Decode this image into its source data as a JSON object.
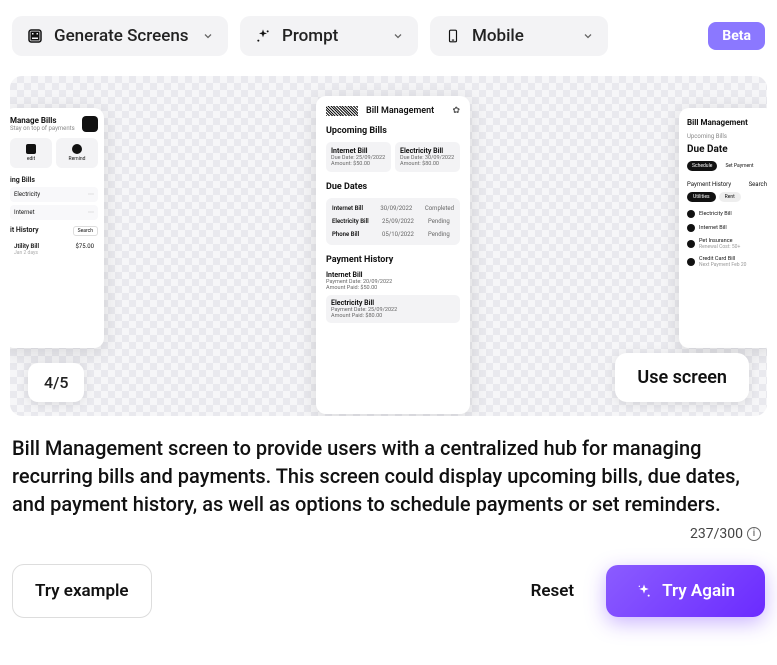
{
  "topbar": {
    "d1": "Generate Screens",
    "d2": "Prompt",
    "d3": "Mobile",
    "beta": "Beta"
  },
  "carousel": {
    "counter": "4/5",
    "use": "Use screen"
  },
  "cardLeft": {
    "title": "Manage Bills",
    "sub": "Stay on top of payments",
    "tab1": "edit",
    "tab2": "Remind",
    "sec1": "ing Bills",
    "r1": "Electricity",
    "r2": "Internet",
    "sec2": "it History",
    "search": "Search",
    "r3": "Jtility Bill",
    "r3s": "Jan 2 days",
    "amt": "$75.00"
  },
  "cardMid": {
    "title": "Bill Management",
    "h1": "Upcoming Bills",
    "p1n": "Internet Bill",
    "p1d1": "Due Date: 25/09/2022",
    "p1d2": "Amount: $50.00",
    "p2n": "Electricity Bill",
    "p2d1": "Due Date: 30/09/2022",
    "p2d2": "Amount: $80.00",
    "h2": "Due Dates",
    "t1a": "Internet Bill",
    "t1b": "30/09/2022",
    "t1c": "Completed",
    "t2a": "Electricity Bill",
    "t2b": "25/09/2022",
    "t2c": "Pending",
    "t3a": "Phone Bill",
    "t3b": "05/10/2022",
    "t3c": "Pending",
    "h3": "Payment History",
    "ph1n": "Internet Bill",
    "ph1d1": "Payment Date: 20/09/2022",
    "ph1d2": "Amount Paid: $50.00",
    "ph2n": "Electricity Bill",
    "ph2d1": "Payment Date: 25/09/2022",
    "ph2d2": "Amount Paid: $80.00"
  },
  "cardRight": {
    "title": "Bill Management",
    "lbl": "Upcoming Bills",
    "big": "Due Date",
    "chip1": "Schedule",
    "chip2": "Set Payment",
    "sec": "Payment History",
    "srch": "Search",
    "p2a": "Utilities",
    "p2b": "Rent",
    "l1": "Electricity Bill",
    "l2": "Internet Bill",
    "l3a": "Pet Insurance",
    "l3b": "Renewal Cost: 50+",
    "l4a": "Credit Card Bill",
    "l4b": "Next Payment Feb 20"
  },
  "description": "Bill Management screen to provide users with a centralized hub for managing recurring bills and payments. This screen could display upcoming bills, due dates, and payment history, as well as options to schedule payments or set reminders.",
  "charCount": "237/300",
  "footer": {
    "tryExample": "Try example",
    "reset": "Reset",
    "tryAgain": "Try Again"
  }
}
